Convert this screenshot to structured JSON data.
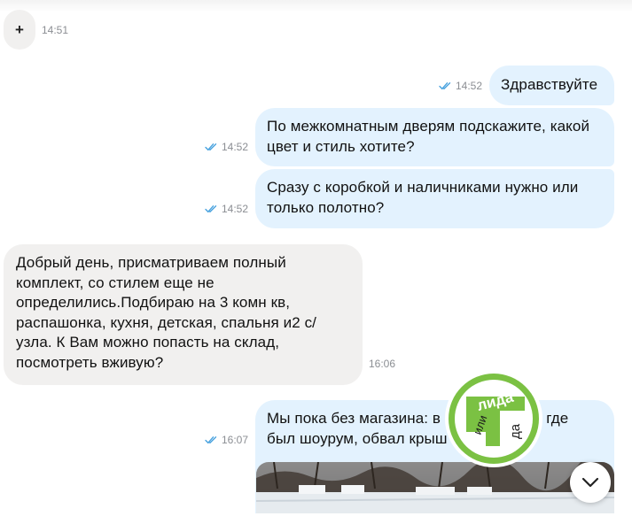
{
  "colors": {
    "incoming_bubble": "#f1f0ef",
    "outgoing_bubble": "#e3f2fe",
    "read_check": "#4aa3df",
    "logo_green": "#7bc143"
  },
  "top": {
    "plus_label": "+",
    "time": "14:51"
  },
  "messages": [
    {
      "direction": "out",
      "time": "14:52",
      "status": "read",
      "lines": [
        "Здравствуйте"
      ]
    },
    {
      "direction": "out",
      "time": "14:52",
      "status": "read",
      "lines": [
        "По межкомнатным дверям подскажите, какой",
        "цвет и стиль хотите?"
      ]
    },
    {
      "direction": "out",
      "time": "14:52",
      "status": "read",
      "lines": [
        "Сразу с коробкой и наличниками нужно или",
        "только полотно?"
      ]
    },
    {
      "direction": "in",
      "time": "16:06",
      "lines": [
        "Добрый день, присматриваем полный",
        "комплект, со стилем еще не",
        "определились.Подбираю на 3 комн кв,",
        "распашонка, кухня, детская, спальня и2 с/",
        "узла. К Вам можно попасть на склад,",
        "посмотреть вживую?"
      ]
    },
    {
      "direction": "out",
      "time": "16:07",
      "status": "read",
      "lines": [
        "Мы пока без магазина: в",
        "»,  где",
        "был шоурум, обвал крыш",
        "."
      ]
    }
  ],
  "photo": {
    "icon": "photo-attachment"
  },
  "scroll_down": {
    "icon": "chevron-down-icon"
  },
  "watermark": {
    "line1": "лида",
    "line2": "или",
    "line3": "да"
  }
}
